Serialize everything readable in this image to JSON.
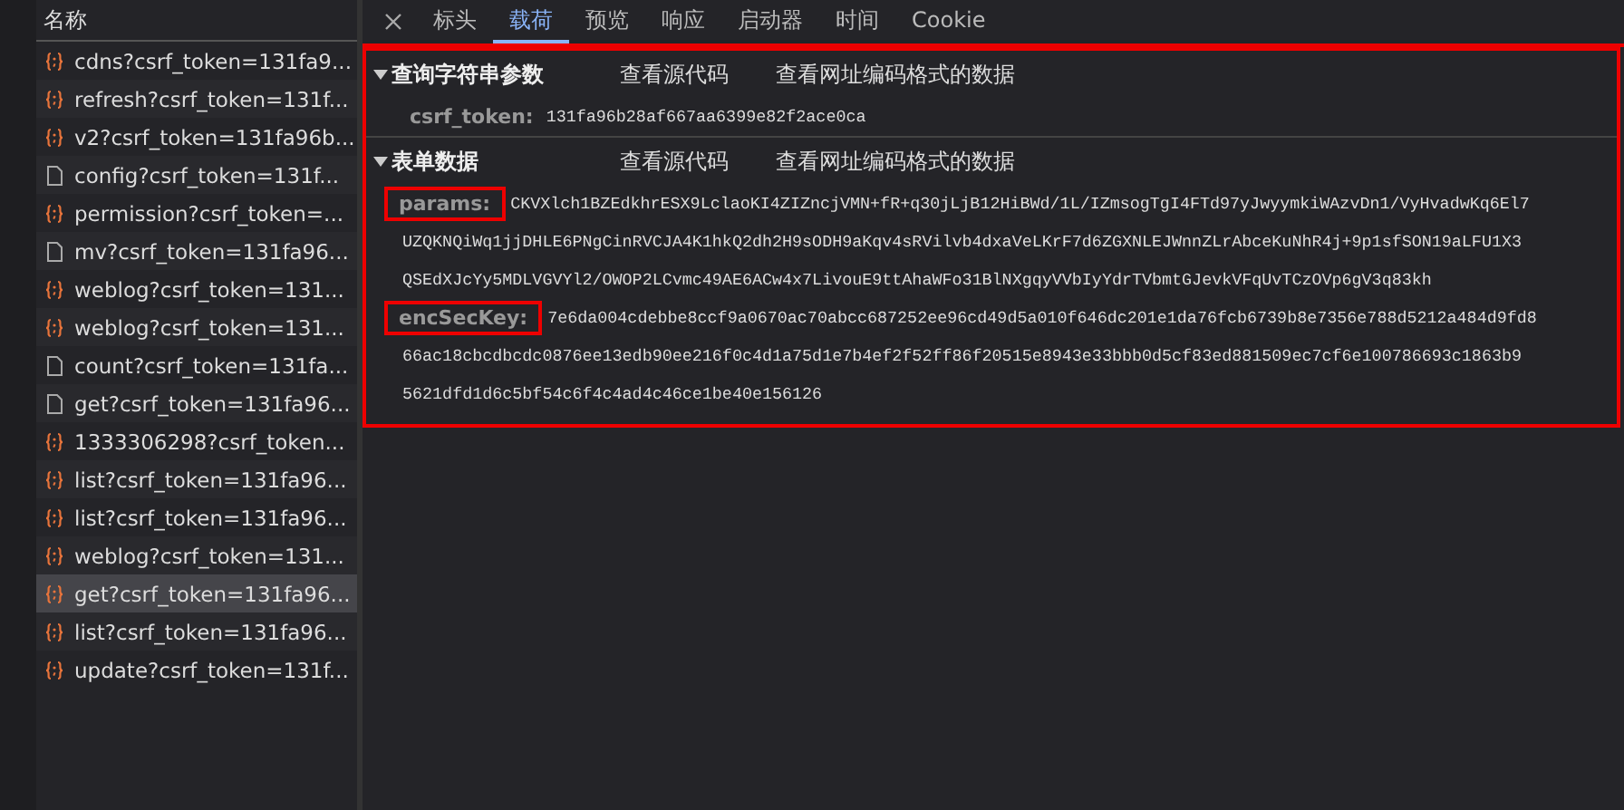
{
  "request_list": {
    "header": "名称",
    "items": [
      {
        "name": "cdns?csrf_token=131fa9...",
        "kind": "script",
        "selected": false
      },
      {
        "name": "refresh?csrf_token=131f...",
        "kind": "script",
        "selected": false
      },
      {
        "name": "v2?csrf_token=131fa96b...",
        "kind": "script",
        "selected": false
      },
      {
        "name": "config?csrf_token=131f...",
        "kind": "document",
        "selected": false
      },
      {
        "name": "permission?csrf_token=...",
        "kind": "script",
        "selected": false
      },
      {
        "name": "mv?csrf_token=131fa96...",
        "kind": "document",
        "selected": false
      },
      {
        "name": "weblog?csrf_token=131...",
        "kind": "script",
        "selected": false
      },
      {
        "name": "weblog?csrf_token=131...",
        "kind": "script",
        "selected": false
      },
      {
        "name": "count?csrf_token=131fa...",
        "kind": "document",
        "selected": false
      },
      {
        "name": "get?csrf_token=131fa96...",
        "kind": "document",
        "selected": false
      },
      {
        "name": "1333306298?csrf_token...",
        "kind": "script",
        "selected": false
      },
      {
        "name": "list?csrf_token=131fa96...",
        "kind": "script",
        "selected": false
      },
      {
        "name": "list?csrf_token=131fa96...",
        "kind": "script",
        "selected": false
      },
      {
        "name": "weblog?csrf_token=131...",
        "kind": "script",
        "selected": false
      },
      {
        "name": "get?csrf_token=131fa96...",
        "kind": "script",
        "selected": true
      },
      {
        "name": "list?csrf_token=131fa96...",
        "kind": "script",
        "selected": false
      },
      {
        "name": "update?csrf_token=131f...",
        "kind": "script",
        "selected": false
      }
    ]
  },
  "tabs": [
    {
      "label": "标头",
      "selected": false
    },
    {
      "label": "载荷",
      "selected": true
    },
    {
      "label": "预览",
      "selected": false
    },
    {
      "label": "响应",
      "selected": false
    },
    {
      "label": "启动器",
      "selected": false
    },
    {
      "label": "时间",
      "selected": false
    },
    {
      "label": "Cookie",
      "selected": false
    }
  ],
  "sections": [
    {
      "title": "查询字符串参数",
      "expanded": true,
      "actions": [
        "查看源代码",
        "查看网址编码格式的数据"
      ],
      "params": [
        {
          "key": "csrf_token:",
          "highlighted": false,
          "lines": [
            "131fa96b28af667aa6399e82f2ace0ca"
          ]
        }
      ]
    },
    {
      "title": "表单数据",
      "expanded": true,
      "actions": [
        "查看源代码",
        "查看网址编码格式的数据"
      ],
      "params": [
        {
          "key": "params:",
          "highlighted": true,
          "lines": [
            "CKVXlch1BZEdkhrESX9LclaoKI4ZIZncjVMN+fR+q30jLjB12HiBWd/1L/IZmsogTgI4FTd97yJwyymkiWAzvDn1/VyHvadwKq6El7",
            "UZQKNQiWq1jjDHLE6PNgCinRVCJA4K1hkQ2dh2H9sODH9aKqv4sRVilvb4dxaVeLKrF7d6ZGXNLEJWnnZLrAbceKuNhR4j+9p1sfSON19aLFU1X3",
            "QSEdXJcYy5MDLVGVYl2/OWOP2LCvmc49AE6ACw4x7LivouE9ttAhaWFo31BlNXgqyVVbIyYdrTVbmtGJevkVFqUvTCzOVp6gV3q83kh"
          ]
        },
        {
          "key": "encSecKey:",
          "highlighted": true,
          "lines": [
            "7e6da004cdebbe8ccf9a0670ac70abcc687252ee96cd49d5a010f646dc201e1da76fcb6739b8e7356e788d5212a484d9fd8",
            "66ac18cbcdbcdc0876ee13edb90ee216f0c4d1a75d1e7b4ef2f52ff86f20515e8943e33bbb0d5cf83ed881509ec7cf6e100786693c1863b9",
            "5621dfd1d6c5bf54c6f4c4ad4c46ce1be40e156126"
          ]
        }
      ]
    }
  ]
}
